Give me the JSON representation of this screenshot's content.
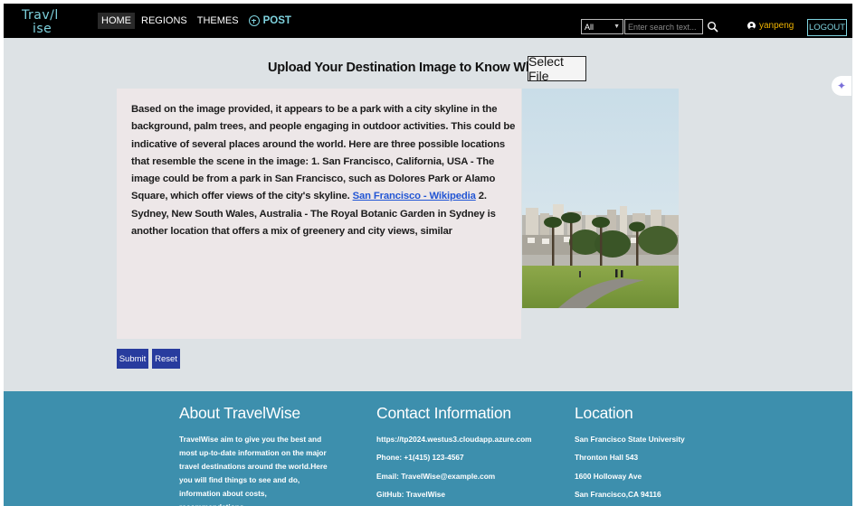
{
  "nav": {
    "logo_line1": "Trav/l",
    "logo_line2": "ise",
    "links": [
      "HOME",
      "REGIONS",
      "THEMES"
    ],
    "post_label": "POST",
    "search_scope": "All",
    "search_placeholder": "Enter search text...",
    "username": "yanpeng",
    "logout_label": "LOGOUT"
  },
  "upload": {
    "title": "Upload Your Destination Image to Know Where It Is!",
    "select_file_label": "Select File"
  },
  "result": {
    "text_before_link": "Based on the image provided, it appears to be a park with a city skyline in the background, palm trees, and people engaging in outdoor activities. This could be indicative of several places around the world. Here are three possible locations that resemble the scene in the image: 1. San Francisco, California, USA - The image could be from a park in San Francisco, such as Dolores Park or Alamo Square, which offer views of the city's skyline. ",
    "link_text": "San Francisco - Wikipedia",
    "text_after_link": " 2. Sydney, New South Wales, Australia - The Royal Botanic Garden in Sydney is another location that offers a mix of greenery and city views, similar"
  },
  "actions": {
    "submit_label": "Submit",
    "reset_label": "Reset"
  },
  "footer": {
    "about": {
      "heading": "About TravelWise",
      "body": "TravelWise aim to give you the best and most up-to-date information on the major travel destinations around the world.Here you will find things to see and do, information about costs, recommendations"
    },
    "contact": {
      "heading": "Contact Information",
      "lines": [
        "https://tp2024.westus3.cloudapp.azure.com",
        "Phone: +1(415) 123-4567",
        "Email: TravelWise@example.com",
        "GitHub: TravelWise"
      ]
    },
    "location": {
      "heading": "Location",
      "lines": [
        "San Francisco State University",
        "Thronton Hall 543",
        "1600 Holloway Ave",
        "San Francisco,CA 94116"
      ]
    }
  },
  "colors": {
    "nav_bg": "#000000",
    "accent_teal": "#7fd3df",
    "username": "#f0b400",
    "page_bg": "#dde2e5",
    "result_bg": "#ede7e8",
    "button": "#283c9e",
    "link": "#2255d4",
    "footer_bg": "#3d8fad"
  }
}
